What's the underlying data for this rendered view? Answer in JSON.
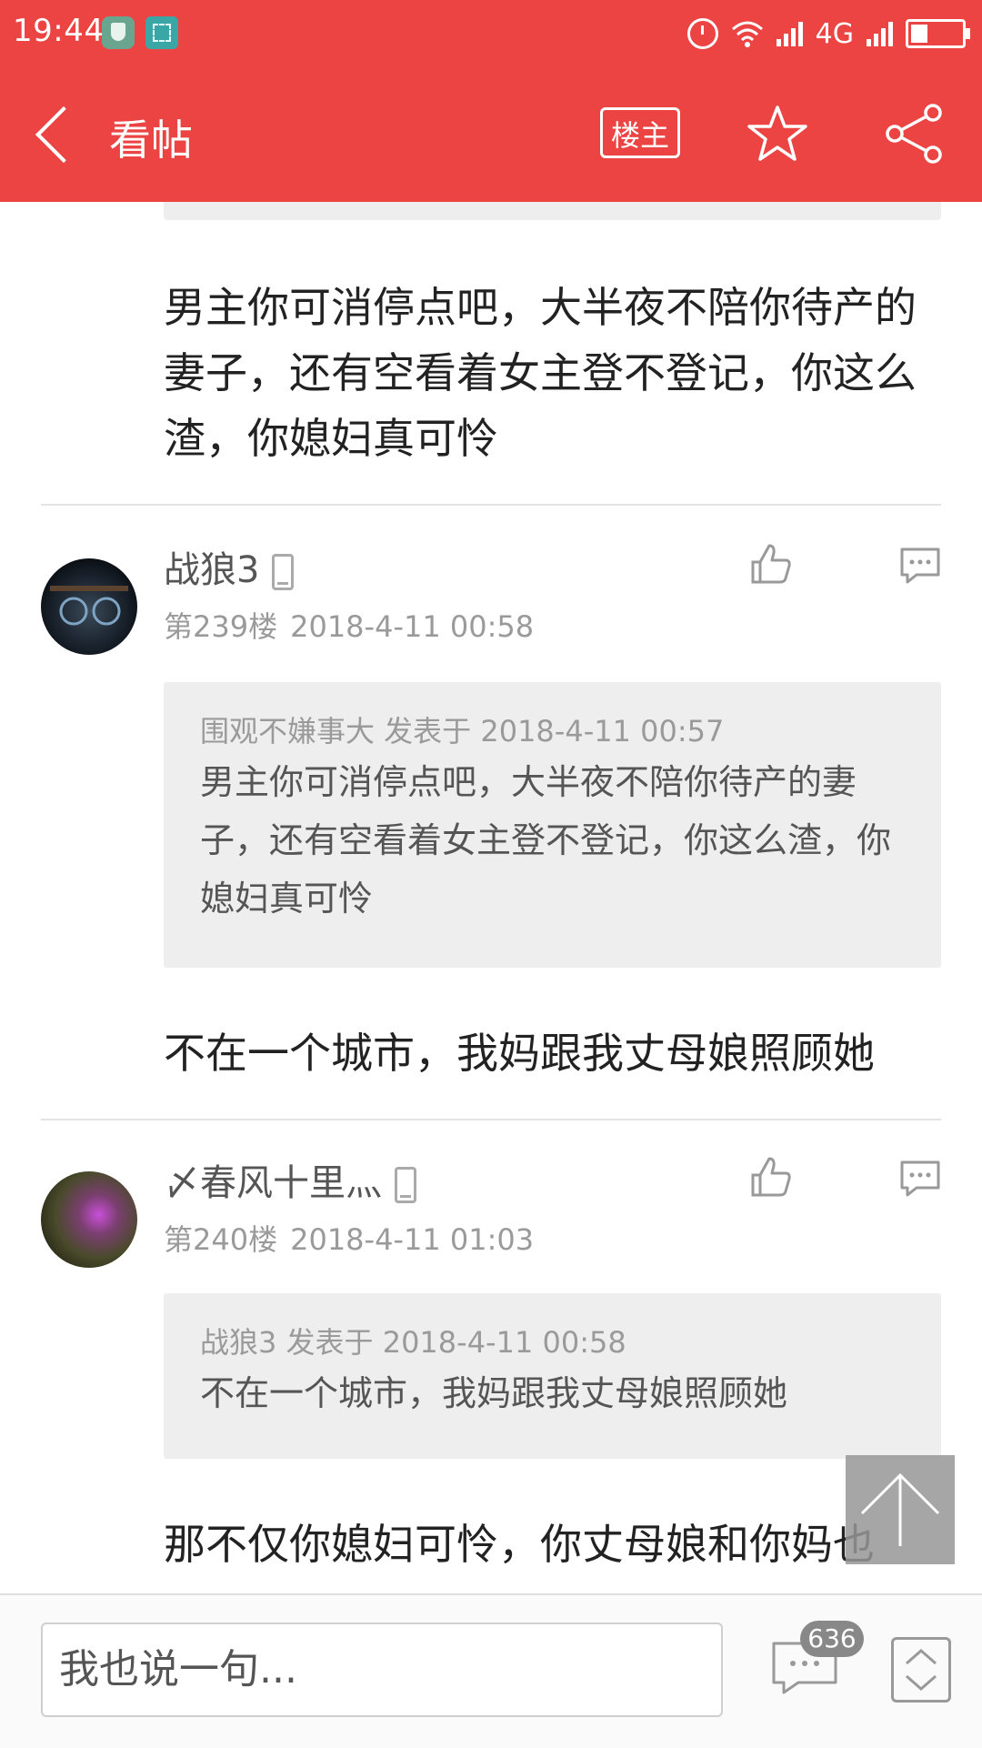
{
  "status_bar": {
    "time": "19:44",
    "network": "4G"
  },
  "nav": {
    "title": "看帖",
    "owner_label": "楼主"
  },
  "posts": [
    {
      "body": "男主你可消停点吧，大半夜不陪你待产的妻子，还有空看着女主登不登记，你这么渣，你媳妇真可怜"
    },
    {
      "username": "战狼3",
      "floor": "第239楼",
      "time": "2018-4-11 00:58",
      "quote_meta": "围观不嫌事大 发表于 2018-4-11 00:57",
      "quote_text": "男主你可消停点吧，大半夜不陪你待产的妻子，还有空看着女主登不登记，你这么渣，你媳妇真可怜",
      "body": "不在一个城市，我妈跟我丈母娘照顾她"
    },
    {
      "username": "〆春风十里灬",
      "floor": "第240楼",
      "time": "2018-4-11 01:03",
      "quote_meta": "战狼3 发表于 2018-4-11 00:58",
      "quote_text": "不在一个城市，我妈跟我丈母娘照顾她",
      "body": "那不仅你媳妇可怜，你丈母娘和你妈也"
    }
  ],
  "bottom_bar": {
    "input_placeholder": "我也说一句...",
    "comment_count": "636"
  }
}
